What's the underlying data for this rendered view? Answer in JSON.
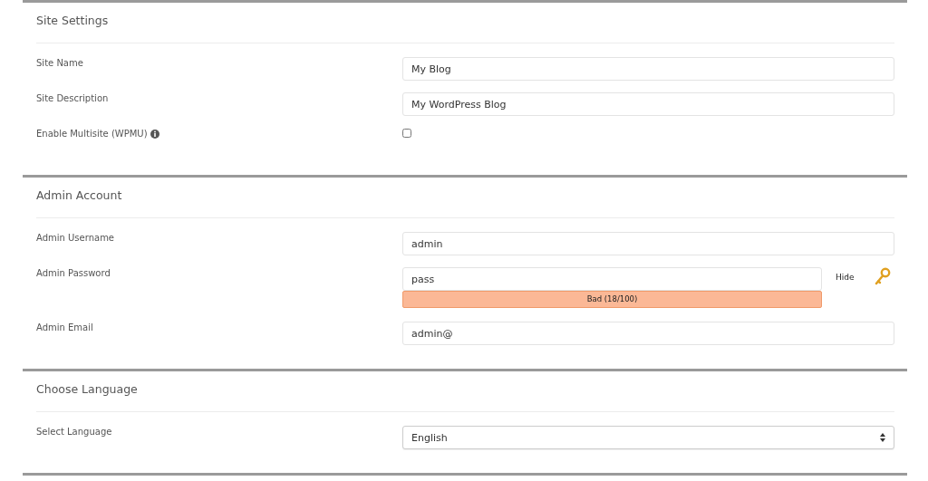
{
  "sections": [
    {
      "title": "Site Settings",
      "fields": [
        {
          "kind": "text",
          "label": "Site Name",
          "value": "My Blog"
        },
        {
          "kind": "text",
          "label": "Site Description",
          "value": "My WordPress Blog"
        },
        {
          "kind": "checkbox",
          "label": "Enable Multisite (WPMU)",
          "info": true,
          "checked": false
        }
      ]
    },
    {
      "title": "Admin Account",
      "fields": [
        {
          "kind": "text",
          "label": "Admin Username",
          "value": "admin"
        },
        {
          "kind": "password",
          "label": "Admin Password",
          "value": "pass",
          "toggle": "Hide",
          "strength": "Bad (18/100)"
        },
        {
          "kind": "text",
          "label": "Admin Email",
          "value": "admin@"
        }
      ]
    },
    {
      "title": "Choose Language",
      "fields": [
        {
          "kind": "select",
          "label": "Select Language",
          "value": "English"
        }
      ]
    }
  ]
}
